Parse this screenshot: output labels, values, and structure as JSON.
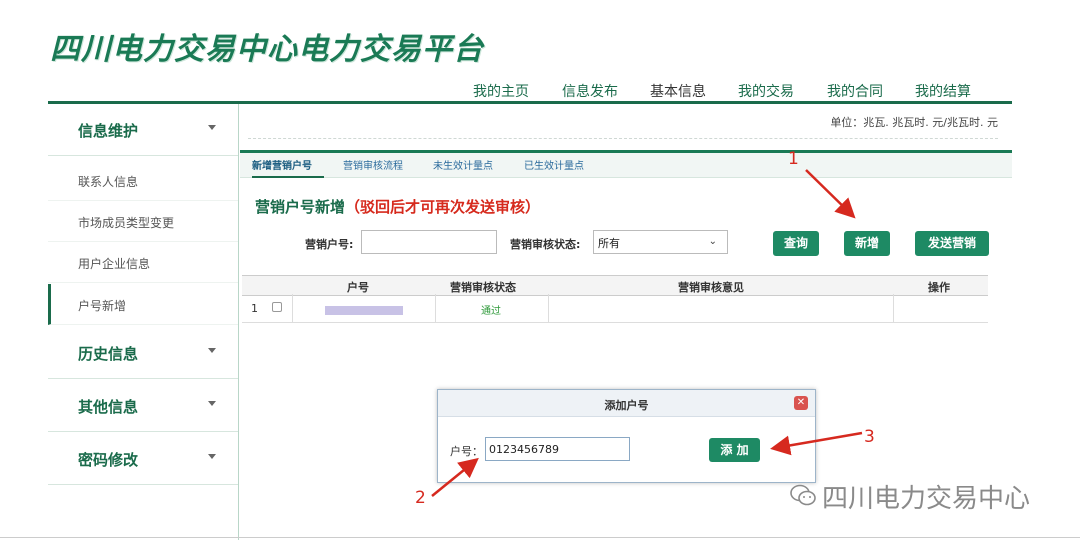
{
  "logo": "四川电力交易中心电力交易平台",
  "nav": {
    "items": [
      "我的主页",
      "信息发布",
      "基本信息",
      "我的交易",
      "我的合同",
      "我的结算"
    ],
    "active_index": 2
  },
  "unit_text": "单位：兆瓦. 兆瓦时. 元/兆瓦时. 元",
  "sidebar": {
    "group1": "信息维护",
    "items": [
      "联系人信息",
      "市场成员类型变更",
      "用户企业信息",
      "户号新增"
    ],
    "active_item": "户号新增",
    "group2": "历史信息",
    "group3": "其他信息",
    "group4": "密码修改"
  },
  "tabs": [
    "新增营销户号",
    "营销审核流程",
    "未生效计量点",
    "已生效计量点"
  ],
  "active_tab": "新增营销户号",
  "section": {
    "title": "营销户号新增",
    "note": "（驳回后才可再次发送审核）"
  },
  "filters": {
    "account_label": "营销户号:",
    "account_value": "",
    "status_label": "营销审核状态:",
    "status_value": "所有"
  },
  "buttons": {
    "query": "查询",
    "add": "新增",
    "send": "发送营销"
  },
  "table": {
    "headers": [
      "户号",
      "营销审核状态",
      "营销审核意见",
      "操作"
    ],
    "rows": [
      {
        "index": "1",
        "status": "通过",
        "opinion": "",
        "action": ""
      }
    ]
  },
  "dialog": {
    "title": "添加户号",
    "label": "户号：",
    "value": "0123456789",
    "button": "添 加"
  },
  "annotations": [
    "1",
    "2",
    "3"
  ],
  "watermark": "四川电力交易中心",
  "colors": {
    "brand_green": "#1a6b4b",
    "button_green": "#1e8a64",
    "note_red": "#d62a1d",
    "arrow_red": "#d6291f",
    "status_green": "#2e9a3a"
  }
}
